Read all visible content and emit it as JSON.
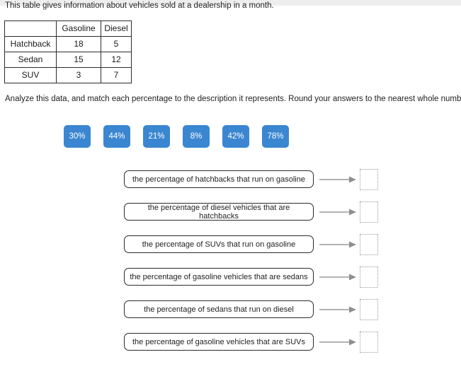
{
  "intro": {
    "text": "This table gives information about vehicles sold at a dealership in a month."
  },
  "table": {
    "corner_label": "",
    "columns": [
      "Gasoline",
      "Diesel"
    ],
    "rows": [
      {
        "label": "Hatchback",
        "gasoline": "18",
        "diesel": "5"
      },
      {
        "label": "Sedan",
        "gasoline": "15",
        "diesel": "12"
      },
      {
        "label": "SUV",
        "gasoline": "3",
        "diesel": "7"
      }
    ]
  },
  "instruction": {
    "text": "Analyze this data, and match each percentage to the description it represents. Round your answers to the nearest whole number."
  },
  "tiles": {
    "color": "#3b86d1",
    "text_color": "#ffffff",
    "items": [
      {
        "label": "30%"
      },
      {
        "label": "44%"
      },
      {
        "label": "21%"
      },
      {
        "label": "8%"
      },
      {
        "label": "42%"
      },
      {
        "label": "78%"
      }
    ]
  },
  "matches": [
    {
      "description": "the percentage of hatchbacks that run on gasoline",
      "answer": ""
    },
    {
      "description": "the percentage of diesel vehicles that are hatchbacks",
      "answer": ""
    },
    {
      "description": "the percentage of SUVs that run on gasoline",
      "answer": ""
    },
    {
      "description": "the percentage of gasoline vehicles that are sedans",
      "answer": ""
    },
    {
      "description": "the percentage of sedans that run on diesel",
      "answer": ""
    },
    {
      "description": "the percentage of gasoline vehicles that are SUVs",
      "answer": ""
    }
  ]
}
